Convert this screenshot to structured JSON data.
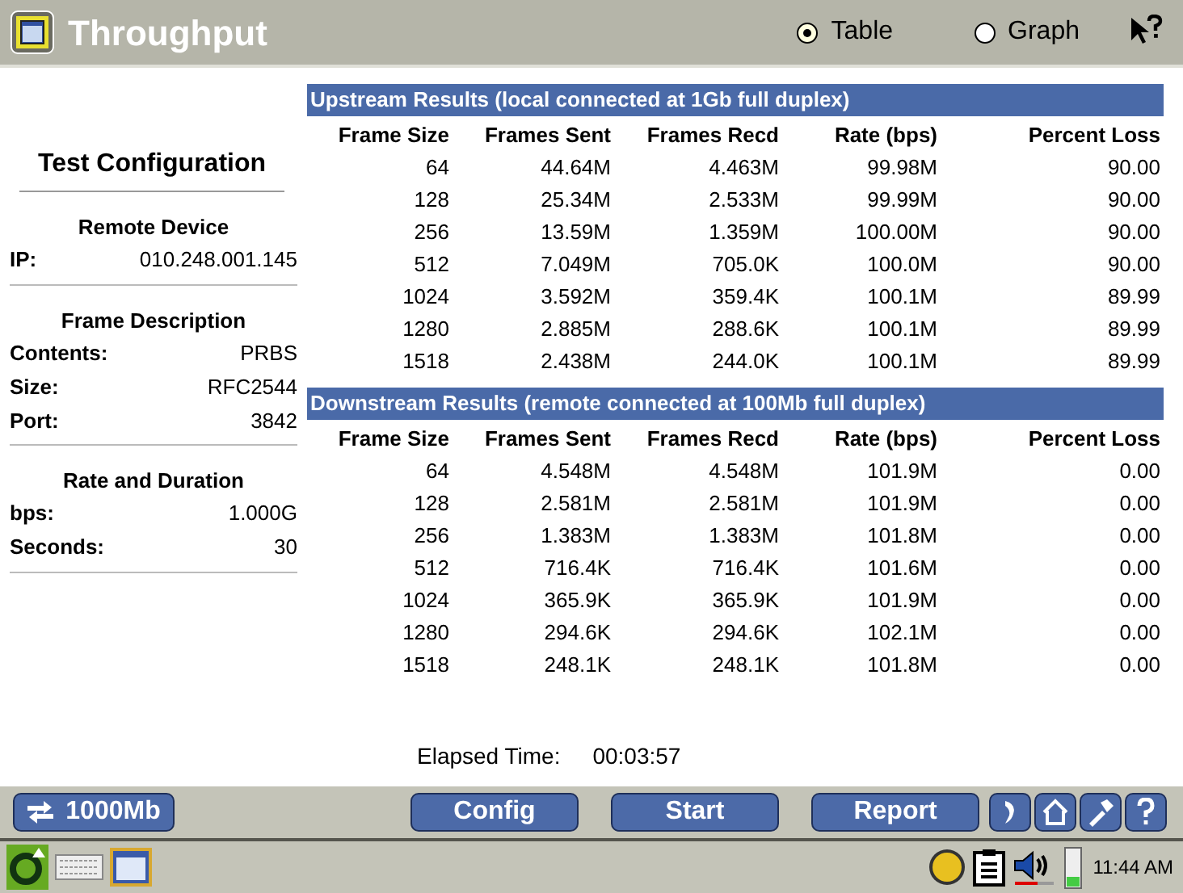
{
  "window": {
    "title": "Throughput"
  },
  "view_options": [
    {
      "label": "Table",
      "selected": true
    },
    {
      "label": "Graph",
      "selected": false
    }
  ],
  "config": {
    "title": "Test Configuration",
    "sections": [
      {
        "heading": "Remote Device",
        "fields": [
          {
            "label": "IP:",
            "value": "010.248.001.145"
          }
        ]
      },
      {
        "heading": "Frame Description",
        "fields": [
          {
            "label": "Contents:",
            "value": "PRBS"
          },
          {
            "label": "Size:",
            "value": "RFC2544"
          },
          {
            "label": "Port:",
            "value": "3842"
          }
        ]
      },
      {
        "heading": "Rate and Duration",
        "fields": [
          {
            "label": "bps:",
            "value": "1.000G"
          },
          {
            "label": "Seconds:",
            "value": "30"
          }
        ]
      }
    ]
  },
  "tables": [
    {
      "title": "Upstream Results (local connected at 1Gb full duplex)",
      "columns": [
        "Frame Size",
        "Frames Sent",
        "Frames Recd",
        "Rate (bps)",
        "Percent Loss"
      ],
      "rows": [
        [
          "64",
          "44.64M",
          "4.463M",
          "99.98M",
          "90.00"
        ],
        [
          "128",
          "25.34M",
          "2.533M",
          "99.99M",
          "90.00"
        ],
        [
          "256",
          "13.59M",
          "1.359M",
          "100.00M",
          "90.00"
        ],
        [
          "512",
          "7.049M",
          "705.0K",
          "100.0M",
          "90.00"
        ],
        [
          "1024",
          "3.592M",
          "359.4K",
          "100.1M",
          "89.99"
        ],
        [
          "1280",
          "2.885M",
          "288.6K",
          "100.1M",
          "89.99"
        ],
        [
          "1518",
          "2.438M",
          "244.0K",
          "100.1M",
          "89.99"
        ]
      ]
    },
    {
      "title": "Downstream Results (remote connected at 100Mb full duplex)",
      "columns": [
        "Frame Size",
        "Frames Sent",
        "Frames Recd",
        "Rate (bps)",
        "Percent Loss"
      ],
      "rows": [
        [
          "64",
          "4.548M",
          "4.548M",
          "101.9M",
          "0.00"
        ],
        [
          "128",
          "2.581M",
          "2.581M",
          "101.9M",
          "0.00"
        ],
        [
          "256",
          "1.383M",
          "1.383M",
          "101.8M",
          "0.00"
        ],
        [
          "512",
          "716.4K",
          "716.4K",
          "101.6M",
          "0.00"
        ],
        [
          "1024",
          "365.9K",
          "365.9K",
          "101.9M",
          "0.00"
        ],
        [
          "1280",
          "294.6K",
          "294.6K",
          "102.1M",
          "0.00"
        ],
        [
          "1518",
          "248.1K",
          "248.1K",
          "101.8M",
          "0.00"
        ]
      ]
    }
  ],
  "elapsed": {
    "label": "Elapsed Time:",
    "value": "00:03:57"
  },
  "buttons": [
    {
      "label": "1000Mb"
    },
    {
      "label": "Config"
    },
    {
      "label": "Start"
    },
    {
      "label": "Report"
    }
  ],
  "taskbar": {
    "time": "11:44 AM"
  }
}
